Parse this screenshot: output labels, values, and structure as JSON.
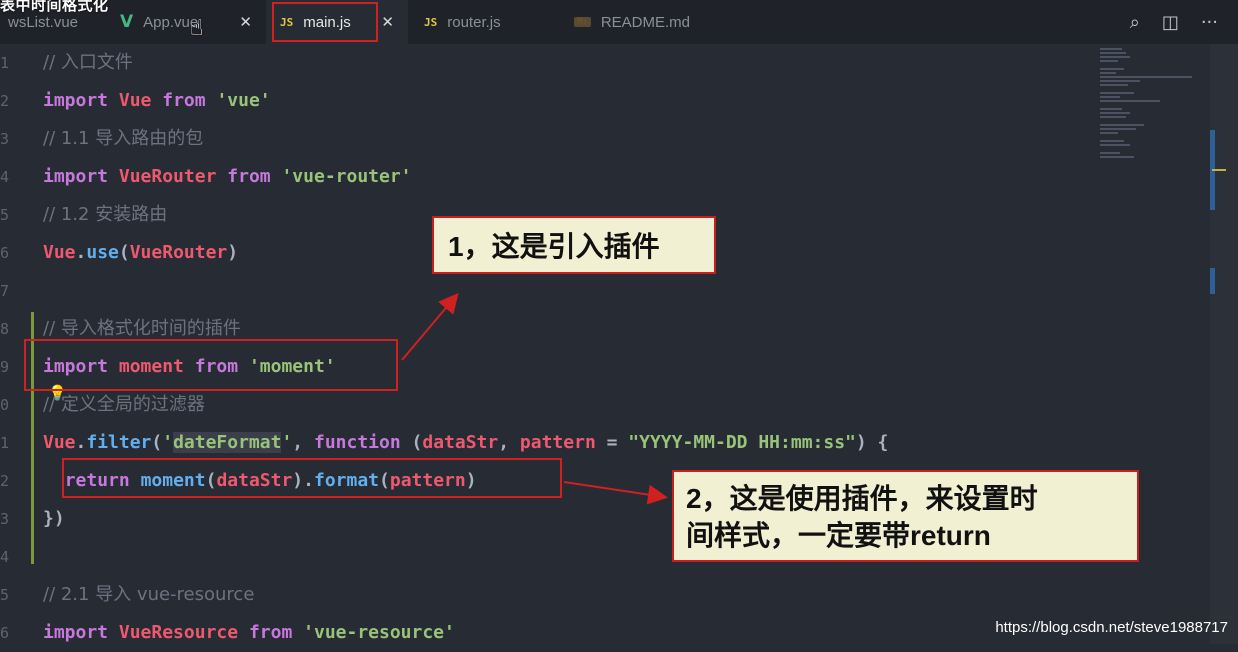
{
  "window": {
    "overlay_title": "表中时间格式化"
  },
  "tabs": [
    {
      "label": "wsList.vue",
      "icon": "vue-file-icon"
    },
    {
      "label": "App.vue",
      "icon": "vue-file-icon",
      "icon_text": "V"
    },
    {
      "label": "main.js",
      "icon": "js-file-icon",
      "icon_text": "JS"
    },
    {
      "label": "router.js",
      "icon": "js-file-icon",
      "icon_text": "JS"
    },
    {
      "label": "README.md",
      "icon": "markdown-file-icon",
      "icon_text": "M↓"
    }
  ],
  "toolbar_icons": [
    "search-icon",
    "split-editor-icon",
    "more-icon"
  ],
  "code_lines": [
    {
      "num": "1",
      "text": "// 入口文件"
    },
    {
      "num": "2",
      "text": "import Vue from 'vue'"
    },
    {
      "num": "3",
      "text": "// 1.1 导入路由的包"
    },
    {
      "num": "4",
      "text": "import VueRouter from 'vue-router'"
    },
    {
      "num": "5",
      "text": "// 1.2 安装路由"
    },
    {
      "num": "6",
      "text": "Vue.use(VueRouter)"
    },
    {
      "num": "7",
      "text": ""
    },
    {
      "num": "8",
      "text": "// 导入格式化时间的插件"
    },
    {
      "num": "9",
      "text": "import moment from 'moment'"
    },
    {
      "num": "0",
      "text": "// 定义全局的过滤器"
    },
    {
      "num": "1",
      "text": "Vue.filter('dateFormat', function (dataStr, pattern = \"YYYY-MM-DD HH:mm:ss\") {"
    },
    {
      "num": "2",
      "text": "  return moment(dataStr).format(pattern)"
    },
    {
      "num": "3",
      "text": "})"
    },
    {
      "num": "4",
      "text": ""
    },
    {
      "num": "5",
      "text": "// 2.1 导入 vue-resource"
    },
    {
      "num": "6",
      "text": "import VueResource from 'vue-resource'"
    }
  ],
  "annotations": {
    "callout1": "1，这是引入插件",
    "callout2_line1": "2，这是使用插件，来设置时",
    "callout2_line2": "间样式，一定要带return"
  },
  "watermark": "https://blog.csdn.net/steve1988717",
  "colors": {
    "keyword": "#c678dd",
    "identifier": "#ef596f",
    "string": "#98c379",
    "comment": "#6b7280",
    "annotation_border": "#d02020",
    "callout_bg": "#f2f0d2"
  }
}
